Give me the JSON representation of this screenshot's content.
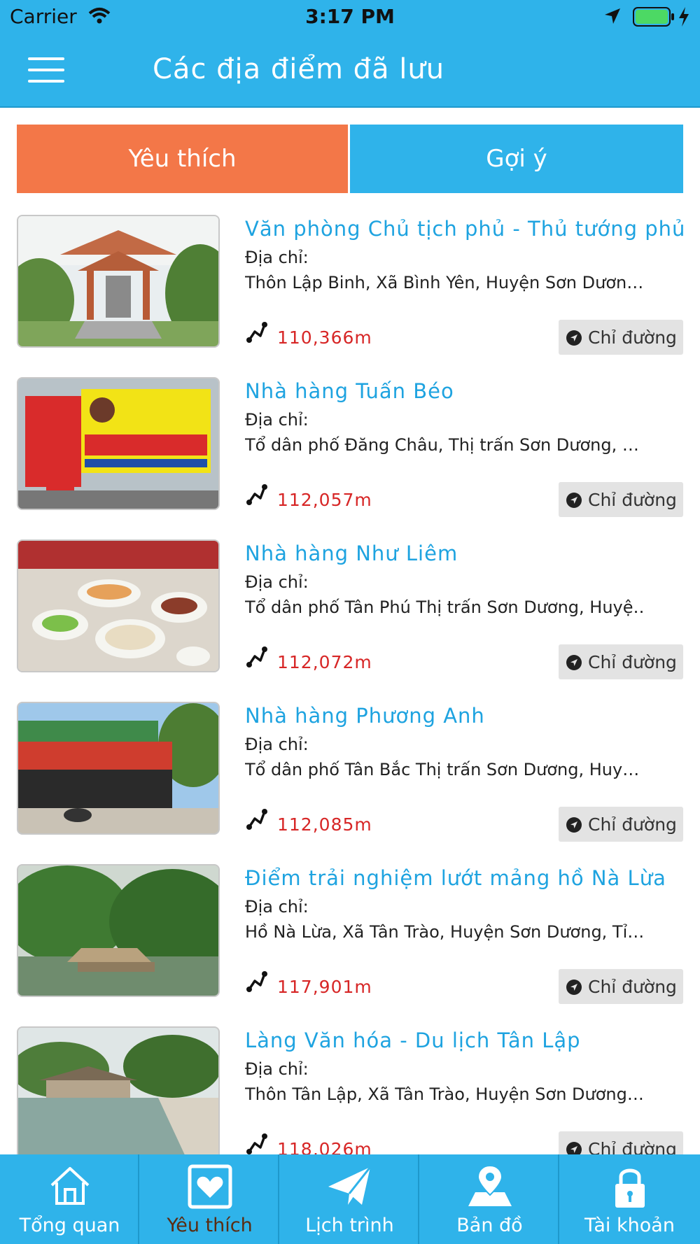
{
  "status_bar": {
    "carrier": "Carrier",
    "time": "3:17 PM"
  },
  "header": {
    "title": "Các địa điểm đã lưu",
    "menu_icon": "hamburger-icon"
  },
  "tabs": [
    {
      "label": "Yêu thích",
      "active": true,
      "color": "#f37748"
    },
    {
      "label": "Gợi ý",
      "active": false,
      "color": "#2fb3ea"
    }
  ],
  "places": [
    {
      "name": "Văn phòng Chủ tịch phủ - Thủ tướng phủ",
      "address_label": "Địa chỉ:",
      "address": "Thôn Lập Binh, Xã Bình Yên, Huyện Sơn Dươn…",
      "distance": "110,366m",
      "directions_label": "Chỉ đường"
    },
    {
      "name": "Nhà hàng Tuấn Béo",
      "address_label": "Địa chỉ:",
      "address": "Tổ dân phố Đăng Châu, Thị trấn Sơn Dương, …",
      "distance": "112,057m",
      "directions_label": "Chỉ đường"
    },
    {
      "name": "Nhà hàng Như Liêm",
      "address_label": "Địa chỉ:",
      "address": "Tổ dân phố Tân Phú Thị trấn Sơn Dương, Huyệ…",
      "distance": "112,072m",
      "directions_label": "Chỉ đường"
    },
    {
      "name": "Nhà hàng Phương Anh",
      "address_label": "Địa chỉ:",
      "address": "Tổ dân phố Tân Bắc Thị trấn Sơn Dương, Huy…",
      "distance": "112,085m",
      "directions_label": "Chỉ đường"
    },
    {
      "name": "Điểm trải nghiệm lướt mảng hồ Nà Lừa",
      "address_label": "Địa chỉ:",
      "address": "Hồ Nà Lừa, Xã Tân Trào, Huyện Sơn Dương, Tỉ…",
      "distance": "117,901m",
      "directions_label": "Chỉ đường"
    },
    {
      "name": "Làng Văn hóa - Du lịch Tân Lập",
      "address_label": "Địa chỉ:",
      "address": "Thôn Tân Lập, Xã Tân Trào, Huyện Sơn Dương…",
      "distance": "118,026m",
      "directions_label": "Chỉ đường"
    }
  ],
  "tab_bar": [
    {
      "label": "Tổng quan",
      "icon": "home-icon",
      "active": false
    },
    {
      "label": "Yêu thích",
      "icon": "heart-icon",
      "active": true
    },
    {
      "label": "Lịch trình",
      "icon": "paper-plane-icon",
      "active": false
    },
    {
      "label": "Bản đồ",
      "icon": "map-pin-icon",
      "active": false
    },
    {
      "label": "Tài khoản",
      "icon": "lock-icon",
      "active": false
    }
  ],
  "colors": {
    "primary": "#2fb3ea",
    "accent": "#f37748",
    "distance": "#d72626",
    "title": "#1ea3e0"
  }
}
